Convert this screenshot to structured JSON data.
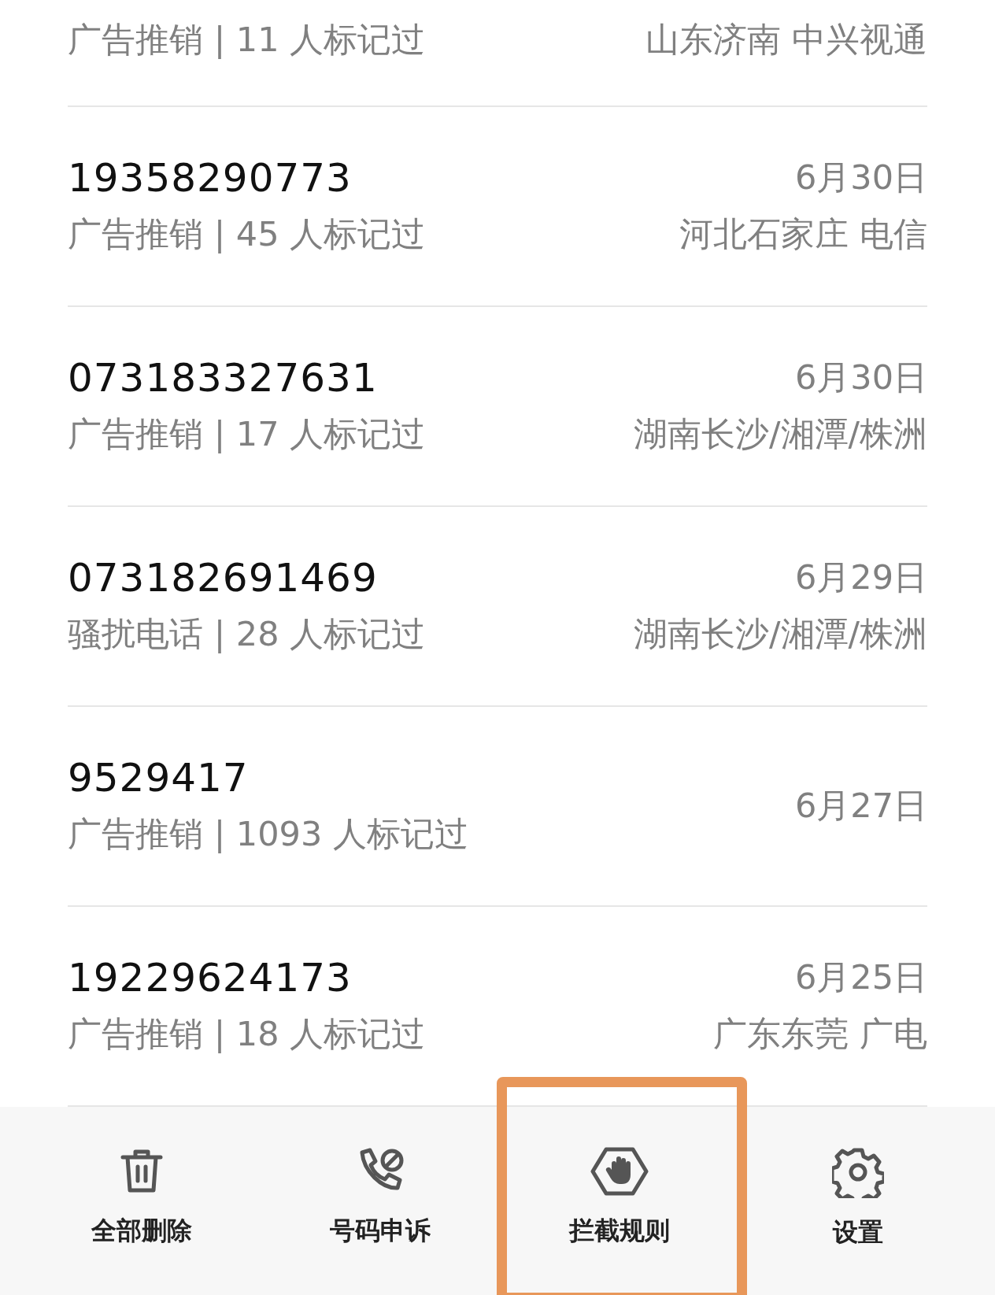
{
  "calls": [
    {
      "detail": "广告推销 | 11 人标记过",
      "location": "山东济南 中兴视通"
    },
    {
      "number": "19358290773",
      "detail": "广告推销 | 45 人标记过",
      "date": "6月30日",
      "location": "河北石家庄 电信"
    },
    {
      "number": "073183327631",
      "detail": "广告推销 | 17 人标记过",
      "date": "6月30日",
      "location": "湖南长沙/湘潭/株洲"
    },
    {
      "number": "073182691469",
      "detail": "骚扰电话 | 28 人标记过",
      "date": "6月29日",
      "location": "湖南长沙/湘潭/株洲"
    },
    {
      "number": "9529417",
      "detail": "广告推销 | 1093 人标记过",
      "date": "6月27日"
    },
    {
      "number": "19229624173",
      "detail": "广告推销 | 18 人标记过",
      "date": "6月25日",
      "location": "广东东莞 广电"
    }
  ],
  "toolbar": [
    {
      "label": "全部删除",
      "kind": "trash",
      "highlighted": false
    },
    {
      "label": "号码申诉",
      "kind": "phone",
      "highlighted": false
    },
    {
      "label": "拦截规则",
      "kind": "block",
      "highlighted": true
    },
    {
      "label": "设置",
      "kind": "settings",
      "highlighted": false
    }
  ]
}
